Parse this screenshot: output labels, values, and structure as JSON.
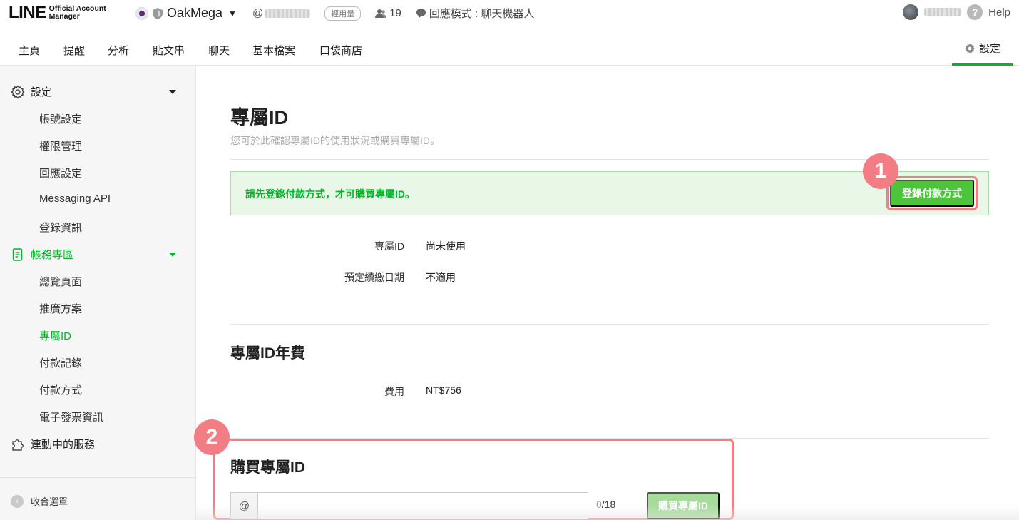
{
  "header": {
    "logo_main": "LINE",
    "logo_sub_line1": "Official Account",
    "logo_sub_line2": "Manager",
    "account_name": "OakMega",
    "account_id_prefix": "@",
    "plan_badge": "輕用量",
    "friends_count": "19",
    "reply_mode": "回應模式 : 聊天機器人",
    "help_label": "Help"
  },
  "nav": {
    "tabs": [
      "主頁",
      "提醒",
      "分析",
      "貼文串",
      "聊天",
      "基本檔案",
      "口袋商店"
    ],
    "settings_label": "設定"
  },
  "sidebar": {
    "group_settings": "設定",
    "settings_items": [
      "帳號設定",
      "權限管理",
      "回應設定",
      "Messaging API",
      "登錄資訊"
    ],
    "group_account": "帳務專區",
    "account_items": [
      "總覽頁面",
      "推廣方案",
      "專屬ID",
      "付款記錄",
      "付款方式",
      "電子發票資訊"
    ],
    "group_services": "連動中的服務",
    "collapse_label": "收合選單"
  },
  "main": {
    "title": "專屬ID",
    "subtitle": "您可於此確認專屬ID的使用狀況或購買專屬ID。",
    "alert_text": "請先登錄付款方式，才可購買專屬ID。",
    "register_button": "登錄付款方式",
    "badge1": "1",
    "badge2": "2",
    "status_label": "專屬ID",
    "status_value": "尚未使用",
    "renew_label": "預定續繳日期",
    "renew_value": "不適用",
    "fee_section_title": "專屬ID年費",
    "fee_label": "費用",
    "fee_value": "NT$756",
    "buy_section_title": "購買專屬ID",
    "input_prefix": "@",
    "input_value": "",
    "counter_current": "0",
    "counter_max": "/18",
    "buy_button": "購買專屬ID"
  },
  "colors": {
    "accent_green": "#06b42a",
    "button_green": "#4cc53b",
    "disabled_green": "#a6dc9a",
    "annotation_red": "#f27d84"
  }
}
